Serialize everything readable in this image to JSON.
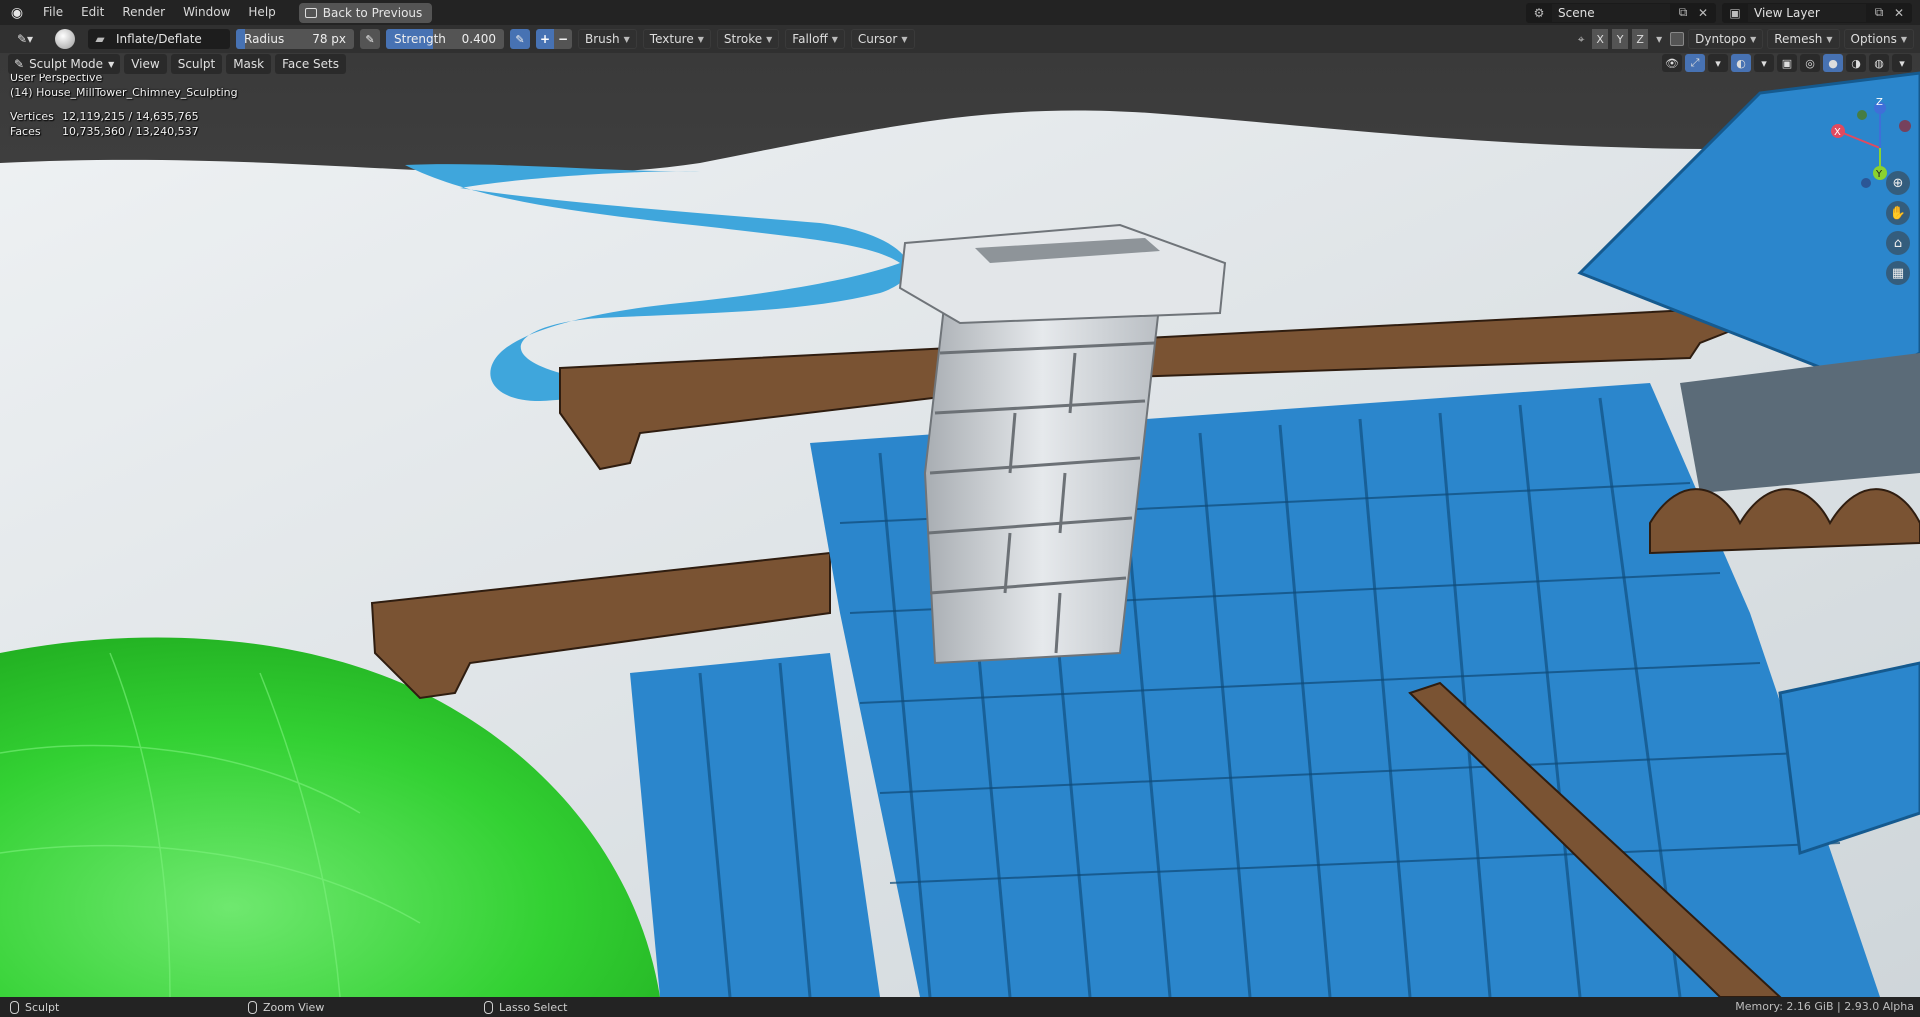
{
  "topbar": {
    "menu": [
      "File",
      "Edit",
      "Render",
      "Window",
      "Help"
    ],
    "back_button": "Back to Previous",
    "scene": "Scene",
    "view_layer": "View Layer"
  },
  "tool_header": {
    "brush_name": "Inflate/Deflate",
    "radius_label": "Radius",
    "radius_value": "78 px",
    "radius_fill_fraction": 0.08,
    "strength_label": "Strength",
    "strength_value": "0.400",
    "strength_fill_fraction": 0.4,
    "dropdowns": [
      "Brush",
      "Texture",
      "Stroke",
      "Falloff",
      "Cursor"
    ],
    "axes": [
      "X",
      "Y",
      "Z"
    ],
    "right_dropdowns": [
      "Dyntopo",
      "Remesh",
      "Options"
    ]
  },
  "mode_bar": {
    "mode": "Sculpt Mode",
    "menus": [
      "View",
      "Sculpt",
      "Mask",
      "Face Sets"
    ]
  },
  "viewport": {
    "perspective": "User Perspective",
    "object": "(14) House_MillTower_Chimney_Sculpting",
    "vertices_label": "Vertices",
    "vertices_value": "12,119,215 / 14,635,765",
    "faces_label": "Faces",
    "faces_value": "10,735,360 / 13,240,537",
    "gizmo_axes": {
      "x": "X",
      "y": "Y",
      "z": "Z"
    }
  },
  "statusbar": {
    "left": "Sculpt",
    "middle": "Zoom View",
    "right_action": "Lasso Select",
    "memory": "Memory: 2.16 GiB | 2.93.0 Alpha"
  },
  "colors": {
    "accent": "#4772b3",
    "roof_tile": "#2e8fd6",
    "wood": "#7a5333",
    "chimney": "#d6d9dc",
    "grass": "#33d133",
    "river": "#3fa6dc"
  }
}
